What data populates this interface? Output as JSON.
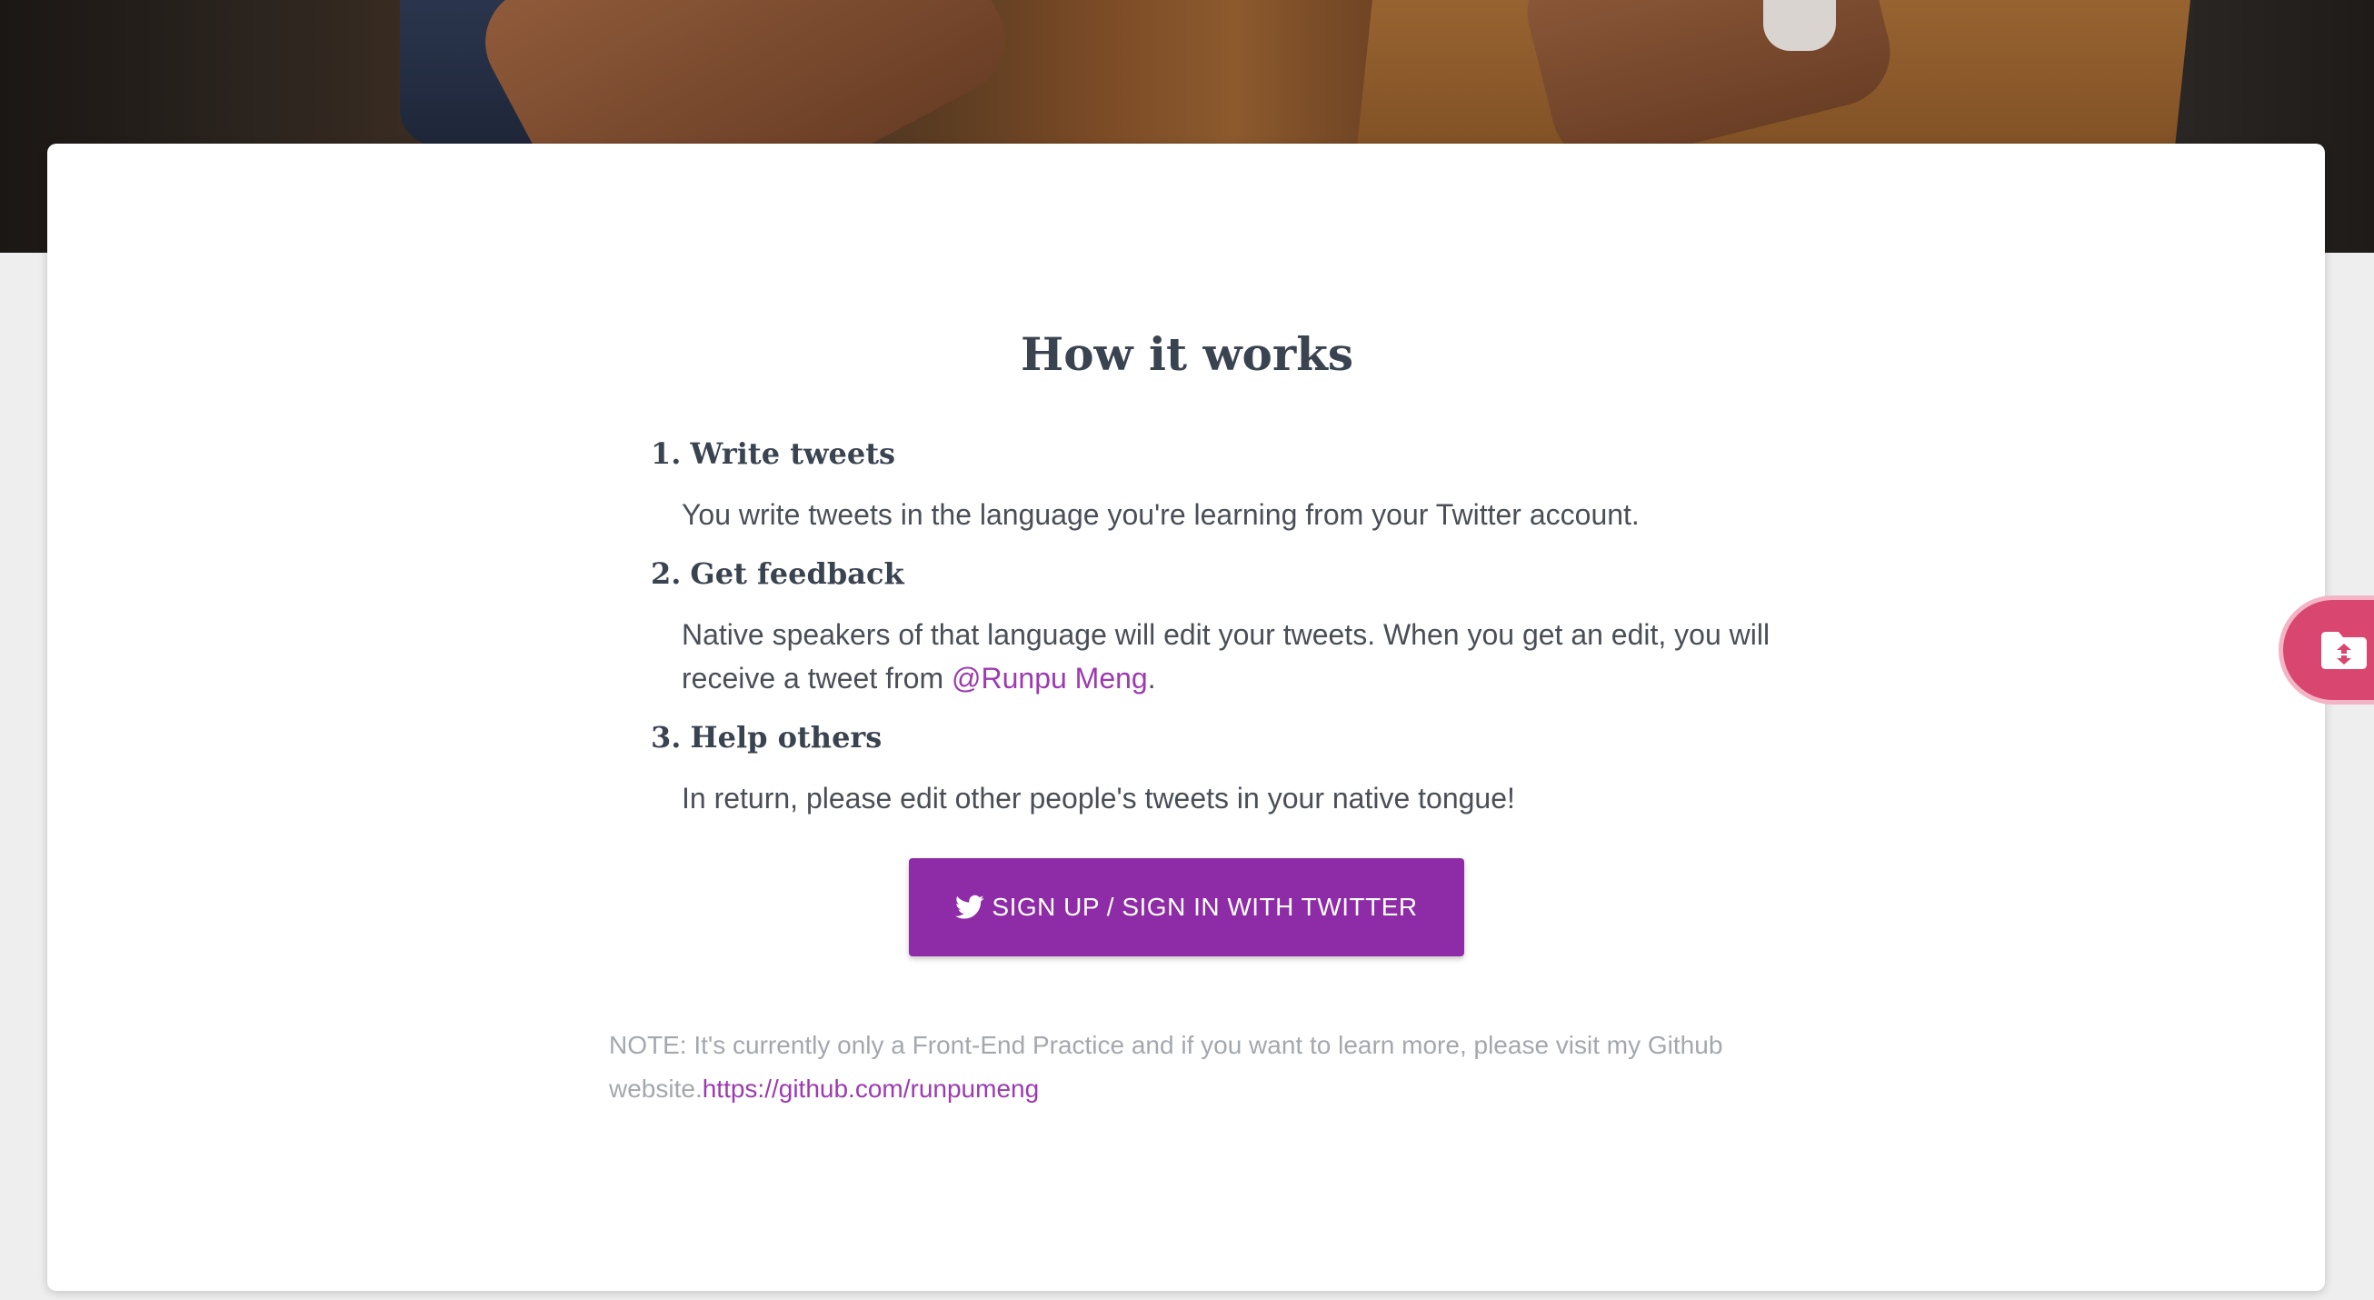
{
  "main": {
    "title": "How it works",
    "steps": [
      {
        "number": "1.",
        "heading": "Write tweets",
        "body": "You write tweets in the language you're learning from your Twitter account."
      },
      {
        "number": "2.",
        "heading": "Get feedback",
        "body_before": "Native speakers of that language will edit your tweets. When you get an edit, you will receive a tweet from ",
        "body_link": "@Runpu Meng",
        "body_after": "."
      },
      {
        "number": "3.",
        "heading": "Help others",
        "body": "In return, please edit other people's tweets in your native tongue!"
      }
    ],
    "cta": {
      "label": "SIGN UP / SIGN IN WITH TWITTER",
      "icon": "twitter-bird-icon"
    },
    "note": {
      "text": "NOTE: It's currently only a Front-End Practice and if you want to learn more, please visit my Github website.",
      "link": "https://github.com/runpumeng"
    }
  },
  "side_widget": {
    "icon": "folder-icon"
  },
  "colors": {
    "accent": "#8e2ba6",
    "link": "#9c3bb0",
    "heading": "#3a4350",
    "side_widget": "#d9466f"
  }
}
